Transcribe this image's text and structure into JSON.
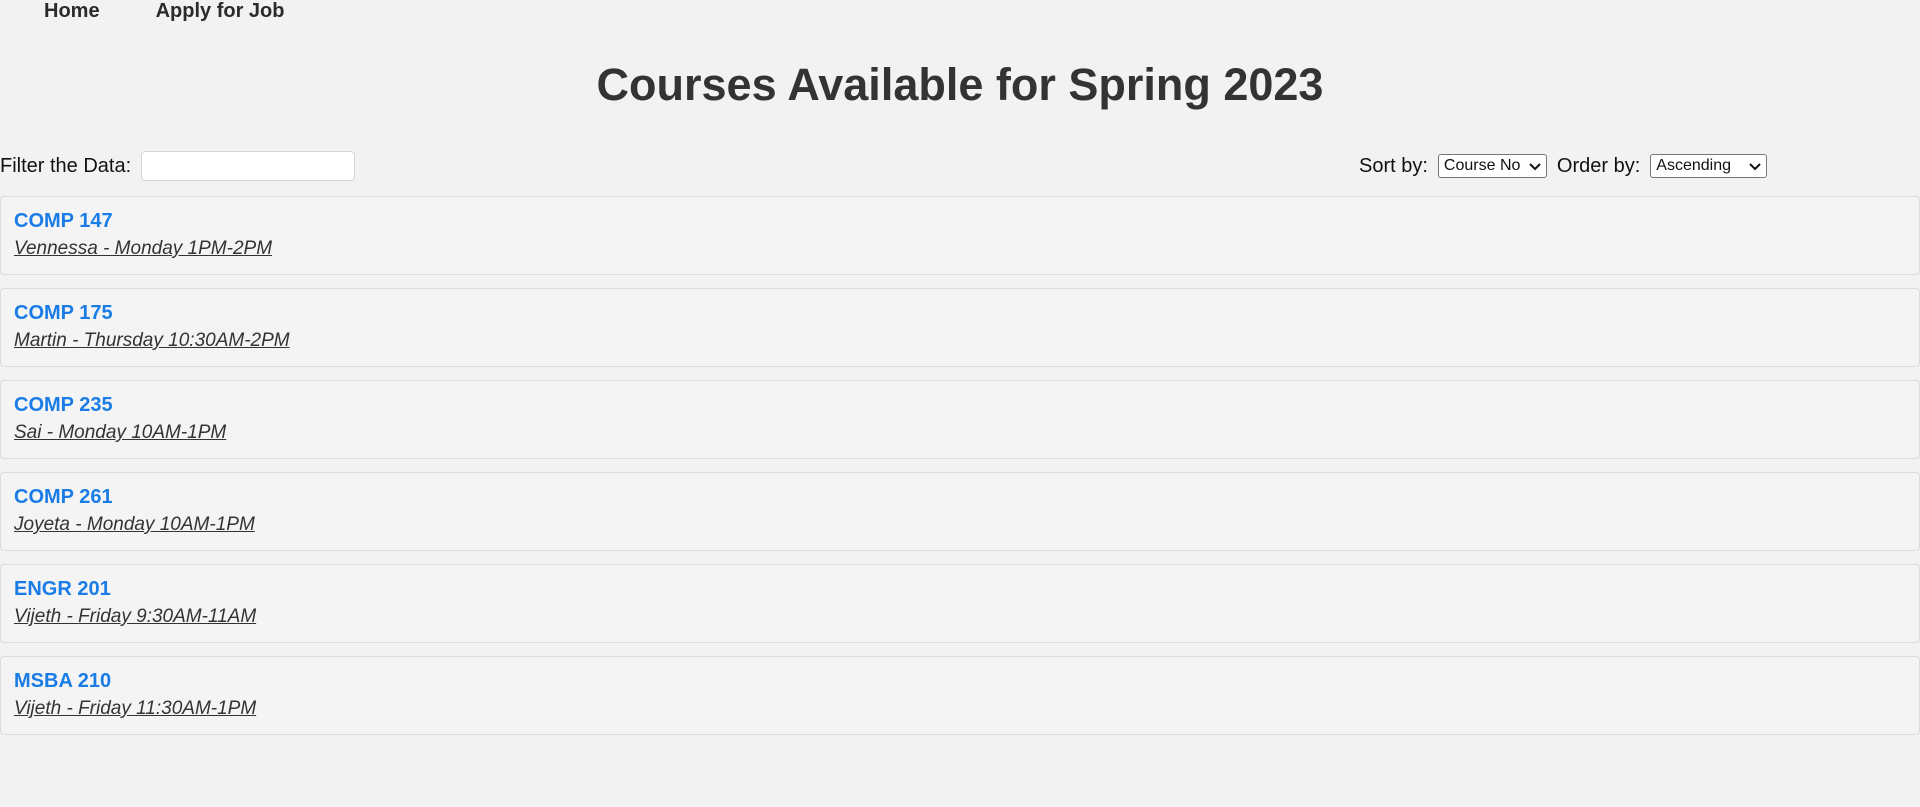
{
  "nav": {
    "items": [
      {
        "label": "Home"
      },
      {
        "label": "Apply for Job"
      }
    ]
  },
  "page": {
    "title": "Courses Available for Spring 2023"
  },
  "filter": {
    "label": "Filter the Data:",
    "value": "",
    "placeholder": ""
  },
  "sort": {
    "label": "Sort by:",
    "selected": "Course No"
  },
  "order": {
    "label": "Order by:",
    "selected": "Ascending"
  },
  "courses": [
    {
      "code": "COMP 147",
      "info": "Vennessa - Monday 1PM-2PM"
    },
    {
      "code": "COMP 175",
      "info": "Martin - Thursday 10:30AM-2PM"
    },
    {
      "code": "COMP 235",
      "info": "Sai - Monday 10AM-1PM"
    },
    {
      "code": "COMP 261",
      "info": "Joyeta - Monday 10AM-1PM"
    },
    {
      "code": "ENGR 201",
      "info": "Vijeth - Friday 9:30AM-11AM"
    },
    {
      "code": "MSBA 210",
      "info": "Vijeth - Friday 11:30AM-1PM"
    }
  ],
  "colors": {
    "background": "#f2f2f2",
    "course_code": "#1a7ce6",
    "text": "#333333"
  }
}
